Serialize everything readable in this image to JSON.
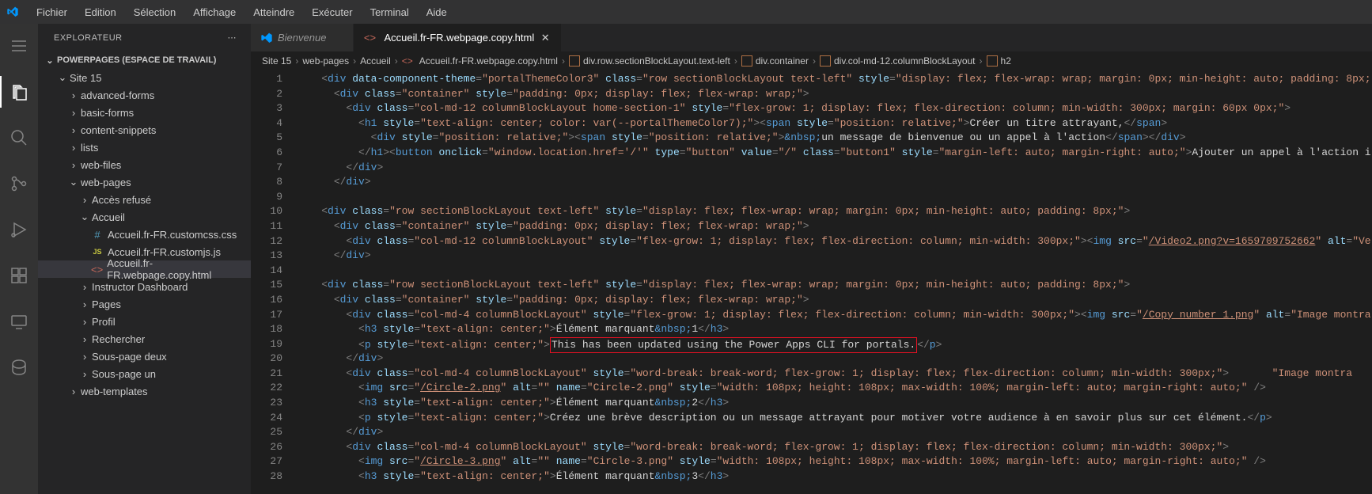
{
  "menubar": [
    "Fichier",
    "Edition",
    "Sélection",
    "Affichage",
    "Atteindre",
    "Exécuter",
    "Terminal",
    "Aide"
  ],
  "sidebar": {
    "title": "EXPLORATEUR",
    "workspace": "POWERPAGES (ESPACE DE TRAVAIL)",
    "root": "Site 15",
    "folders": [
      "advanced-forms",
      "basic-forms",
      "content-snippets",
      "lists",
      "web-files"
    ],
    "webpages": "web-pages",
    "webpages_children": [
      "Accès refusé"
    ],
    "accueil": "Accueil",
    "accueil_files": [
      {
        "name": "Accueil.fr-FR.customcss.css",
        "type": "css",
        "sym": "#"
      },
      {
        "name": "Accueil.fr-FR.customjs.js",
        "type": "js",
        "sym": "JS"
      },
      {
        "name": "Accueil.fr-FR.webpage.copy.html",
        "type": "html",
        "sym": "<>",
        "active": true
      }
    ],
    "after_accueil": [
      "Instructor Dashboard",
      "Pages",
      "Profil",
      "Rechercher",
      "Sous-page deux",
      "Sous-page un"
    ],
    "after_webpages": [
      "web-templates"
    ]
  },
  "tabs": [
    {
      "label": "Bienvenue",
      "active": false,
      "icon": "vscode"
    },
    {
      "label": "Accueil.fr-FR.webpage.copy.html",
      "active": true,
      "icon": "html"
    }
  ],
  "breadcrumbs": [
    {
      "text": "Site 15",
      "kind": "plain"
    },
    {
      "text": "web-pages",
      "kind": "plain"
    },
    {
      "text": "Accueil",
      "kind": "plain"
    },
    {
      "text": "Accueil.fr-FR.webpage.copy.html",
      "kind": "file"
    },
    {
      "text": "div.row.sectionBlockLayout.text-left",
      "kind": "symbol"
    },
    {
      "text": "div.container",
      "kind": "symbol"
    },
    {
      "text": "div.col-md-12.columnBlockLayout",
      "kind": "symbol"
    },
    {
      "text": "h2",
      "kind": "symbol"
    }
  ],
  "line_start": 1,
  "line_end": 28,
  "code_lines": [
    [
      [
        "    ",
        "t-text"
      ],
      [
        "<",
        "t-br"
      ],
      [
        "div",
        "t-tag"
      ],
      [
        " data-component-theme",
        "t-attr"
      ],
      [
        "=",
        "t-br"
      ],
      [
        "\"portalThemeColor3\"",
        "t-str"
      ],
      [
        " class",
        "t-attr"
      ],
      [
        "=",
        "t-br"
      ],
      [
        "\"row sectionBlockLayout text-left\"",
        "t-str"
      ],
      [
        " style",
        "t-attr"
      ],
      [
        "=",
        "t-br"
      ],
      [
        "\"display: flex; flex-wrap: wrap; margin: 0px; min-height: auto; padding: 8px;",
        "t-str"
      ]
    ],
    [
      [
        "      ",
        "t-text"
      ],
      [
        "<",
        "t-br"
      ],
      [
        "div",
        "t-tag"
      ],
      [
        " class",
        "t-attr"
      ],
      [
        "=",
        "t-br"
      ],
      [
        "\"container\"",
        "t-str"
      ],
      [
        " style",
        "t-attr"
      ],
      [
        "=",
        "t-br"
      ],
      [
        "\"padding: 0px; display: flex; flex-wrap: wrap;\"",
        "t-str"
      ],
      [
        ">",
        "t-br"
      ]
    ],
    [
      [
        "        ",
        "t-text"
      ],
      [
        "<",
        "t-br"
      ],
      [
        "div",
        "t-tag"
      ],
      [
        " class",
        "t-attr"
      ],
      [
        "=",
        "t-br"
      ],
      [
        "\"col-md-12 columnBlockLayout home-section-1\"",
        "t-str"
      ],
      [
        " style",
        "t-attr"
      ],
      [
        "=",
        "t-br"
      ],
      [
        "\"flex-grow: 1; display: flex; flex-direction: column; min-width: 300px; margin: 60px 0px;\"",
        "t-str"
      ],
      [
        ">",
        "t-br"
      ]
    ],
    [
      [
        "          ",
        "t-text"
      ],
      [
        "<",
        "t-br"
      ],
      [
        "h1",
        "t-tag"
      ],
      [
        " style",
        "t-attr"
      ],
      [
        "=",
        "t-br"
      ],
      [
        "\"text-align: center; color: var(--portalThemeColor7);\"",
        "t-str"
      ],
      [
        ">",
        "t-br"
      ],
      [
        "<",
        "t-br"
      ],
      [
        "span",
        "t-tag"
      ],
      [
        " style",
        "t-attr"
      ],
      [
        "=",
        "t-br"
      ],
      [
        "\"position: relative;\"",
        "t-str"
      ],
      [
        ">",
        "t-br"
      ],
      [
        "Créer un titre attrayant,",
        "t-text"
      ],
      [
        "</",
        "t-br"
      ],
      [
        "span",
        "t-tag"
      ],
      [
        ">",
        "t-br"
      ]
    ],
    [
      [
        "            ",
        "t-text"
      ],
      [
        "<",
        "t-br"
      ],
      [
        "div",
        "t-tag"
      ],
      [
        " style",
        "t-attr"
      ],
      [
        "=",
        "t-br"
      ],
      [
        "\"position: relative;\"",
        "t-str"
      ],
      [
        ">",
        "t-br"
      ],
      [
        "<",
        "t-br"
      ],
      [
        "span",
        "t-tag"
      ],
      [
        " style",
        "t-attr"
      ],
      [
        "=",
        "t-br"
      ],
      [
        "\"position: relative;\"",
        "t-str"
      ],
      [
        ">",
        "t-br"
      ],
      [
        "&nbsp;",
        "t-ent"
      ],
      [
        "un message de bienvenue ou un appel à l'action",
        "t-text"
      ],
      [
        "</",
        "t-br"
      ],
      [
        "span",
        "t-tag"
      ],
      [
        ">",
        "t-br"
      ],
      [
        "</",
        "t-br"
      ],
      [
        "div",
        "t-tag"
      ],
      [
        ">",
        "t-br"
      ]
    ],
    [
      [
        "          ",
        "t-text"
      ],
      [
        "</",
        "t-br"
      ],
      [
        "h1",
        "t-tag"
      ],
      [
        ">",
        "t-br"
      ],
      [
        "<",
        "t-br"
      ],
      [
        "button",
        "t-tag"
      ],
      [
        " onclick",
        "t-attr"
      ],
      [
        "=",
        "t-br"
      ],
      [
        "\"window.location.href='/'\"",
        "t-str"
      ],
      [
        " type",
        "t-attr"
      ],
      [
        "=",
        "t-br"
      ],
      [
        "\"button\"",
        "t-str"
      ],
      [
        " value",
        "t-attr"
      ],
      [
        "=",
        "t-br"
      ],
      [
        "\"/\"",
        "t-str"
      ],
      [
        " class",
        "t-attr"
      ],
      [
        "=",
        "t-br"
      ],
      [
        "\"button1\"",
        "t-str"
      ],
      [
        " style",
        "t-attr"
      ],
      [
        "=",
        "t-br"
      ],
      [
        "\"margin-left: auto; margin-right: auto;\"",
        "t-str"
      ],
      [
        ">",
        "t-br"
      ],
      [
        "Ajouter un appel à l'action i",
        "t-text"
      ]
    ],
    [
      [
        "        ",
        "t-text"
      ],
      [
        "</",
        "t-br"
      ],
      [
        "div",
        "t-tag"
      ],
      [
        ">",
        "t-br"
      ]
    ],
    [
      [
        "      ",
        "t-text"
      ],
      [
        "</",
        "t-br"
      ],
      [
        "div",
        "t-tag"
      ],
      [
        ">",
        "t-br"
      ]
    ],
    [
      [
        "",
        "t-text"
      ]
    ],
    [
      [
        "    ",
        "t-text"
      ],
      [
        "<",
        "t-br"
      ],
      [
        "div",
        "t-tag"
      ],
      [
        " class",
        "t-attr"
      ],
      [
        "=",
        "t-br"
      ],
      [
        "\"row sectionBlockLayout text-left\"",
        "t-str"
      ],
      [
        " style",
        "t-attr"
      ],
      [
        "=",
        "t-br"
      ],
      [
        "\"display: flex; flex-wrap: wrap; margin: 0px; min-height: auto; padding: 8px;\"",
        "t-str"
      ],
      [
        ">",
        "t-br"
      ]
    ],
    [
      [
        "      ",
        "t-text"
      ],
      [
        "<",
        "t-br"
      ],
      [
        "div",
        "t-tag"
      ],
      [
        " class",
        "t-attr"
      ],
      [
        "=",
        "t-br"
      ],
      [
        "\"container\"",
        "t-str"
      ],
      [
        " style",
        "t-attr"
      ],
      [
        "=",
        "t-br"
      ],
      [
        "\"padding: 0px; display: flex; flex-wrap: wrap;\"",
        "t-str"
      ],
      [
        ">",
        "t-br"
      ]
    ],
    [
      [
        "        ",
        "t-text"
      ],
      [
        "<",
        "t-br"
      ],
      [
        "div",
        "t-tag"
      ],
      [
        " class",
        "t-attr"
      ],
      [
        "=",
        "t-br"
      ],
      [
        "\"col-md-12 columnBlockLayout\"",
        "t-str"
      ],
      [
        " style",
        "t-attr"
      ],
      [
        "=",
        "t-br"
      ],
      [
        "\"flex-grow: 1; display: flex; flex-direction: column; min-width: 300px;\"",
        "t-str"
      ],
      [
        ">",
        "t-br"
      ],
      [
        "<",
        "t-br"
      ],
      [
        "img",
        "t-tag"
      ],
      [
        " src",
        "t-attr"
      ],
      [
        "=",
        "t-br"
      ],
      [
        "\"",
        "t-str"
      ],
      [
        "/Video2.png?v=1659709752662",
        "t-link"
      ],
      [
        "\"",
        "t-str"
      ],
      [
        " alt",
        "t-attr"
      ],
      [
        "=",
        "t-br"
      ],
      [
        "\"Ve",
        "t-str"
      ]
    ],
    [
      [
        "      ",
        "t-text"
      ],
      [
        "</",
        "t-br"
      ],
      [
        "div",
        "t-tag"
      ],
      [
        ">",
        "t-br"
      ]
    ],
    [
      [
        "",
        "t-text"
      ]
    ],
    [
      [
        "    ",
        "t-text"
      ],
      [
        "<",
        "t-br"
      ],
      [
        "div",
        "t-tag"
      ],
      [
        " class",
        "t-attr"
      ],
      [
        "=",
        "t-br"
      ],
      [
        "\"row sectionBlockLayout text-left\"",
        "t-str"
      ],
      [
        " style",
        "t-attr"
      ],
      [
        "=",
        "t-br"
      ],
      [
        "\"display: flex; flex-wrap: wrap; margin: 0px; min-height: auto; padding: 8px;\"",
        "t-str"
      ],
      [
        ">",
        "t-br"
      ]
    ],
    [
      [
        "      ",
        "t-text"
      ],
      [
        "<",
        "t-br"
      ],
      [
        "div",
        "t-tag"
      ],
      [
        " class",
        "t-attr"
      ],
      [
        "=",
        "t-br"
      ],
      [
        "\"container\"",
        "t-str"
      ],
      [
        " style",
        "t-attr"
      ],
      [
        "=",
        "t-br"
      ],
      [
        "\"padding: 0px; display: flex; flex-wrap: wrap;\"",
        "t-str"
      ],
      [
        ">",
        "t-br"
      ]
    ],
    [
      [
        "        ",
        "t-text"
      ],
      [
        "<",
        "t-br"
      ],
      [
        "div",
        "t-tag"
      ],
      [
        " class",
        "t-attr"
      ],
      [
        "=",
        "t-br"
      ],
      [
        "\"col-md-4 columnBlockLayout\"",
        "t-str"
      ],
      [
        " style",
        "t-attr"
      ],
      [
        "=",
        "t-br"
      ],
      [
        "\"flex-grow: 1; display: flex; flex-direction: column; min-width: 300px;\"",
        "t-str"
      ],
      [
        ">",
        "t-br"
      ],
      [
        "<",
        "t-br"
      ],
      [
        "img",
        "t-tag"
      ],
      [
        " src",
        "t-attr"
      ],
      [
        "=",
        "t-br"
      ],
      [
        "\"",
        "t-str"
      ],
      [
        "/Copy number 1.png",
        "t-link"
      ],
      [
        "\"",
        "t-str"
      ],
      [
        " alt",
        "t-attr"
      ],
      [
        "=",
        "t-br"
      ],
      [
        "\"Image montra",
        "t-str"
      ]
    ],
    [
      [
        "          ",
        "t-text"
      ],
      [
        "<",
        "t-br"
      ],
      [
        "h3",
        "t-tag"
      ],
      [
        " style",
        "t-attr"
      ],
      [
        "=",
        "t-br"
      ],
      [
        "\"text-align: center;\"",
        "t-str"
      ],
      [
        ">",
        "t-br"
      ],
      [
        "Élément marquant",
        "t-text"
      ],
      [
        "&nbsp;",
        "t-ent"
      ],
      [
        "1",
        "t-text"
      ],
      [
        "</",
        "t-br"
      ],
      [
        "h3",
        "t-tag"
      ],
      [
        ">",
        "t-br"
      ]
    ],
    [
      [
        "          ",
        "t-text"
      ],
      [
        "<",
        "t-br"
      ],
      [
        "p",
        "t-tag"
      ],
      [
        " style",
        "t-attr"
      ],
      [
        "=",
        "t-br"
      ],
      [
        "\"text-align: center;\"",
        "t-str"
      ],
      [
        ">",
        "t-br"
      ],
      [
        "REDBOX_START",
        "t-text"
      ],
      [
        "This has been updated using the Power Apps CLI for portals.",
        "t-text"
      ],
      [
        "REDBOX_END",
        "t-text"
      ],
      [
        "</",
        "t-br"
      ],
      [
        "p",
        "t-tag"
      ],
      [
        ">",
        "t-br"
      ]
    ],
    [
      [
        "        ",
        "t-text"
      ],
      [
        "</",
        "t-br"
      ],
      [
        "div",
        "t-tag"
      ],
      [
        ">",
        "t-br"
      ]
    ],
    [
      [
        "        ",
        "t-text"
      ],
      [
        "<",
        "t-br"
      ],
      [
        "div",
        "t-tag"
      ],
      [
        " class",
        "t-attr"
      ],
      [
        "=",
        "t-br"
      ],
      [
        "\"col-md-4 columnBlockLayout\"",
        "t-str"
      ],
      [
        " style",
        "t-attr"
      ],
      [
        "=",
        "t-br"
      ],
      [
        "\"word-break: break-word; flex-grow: 1; display: flex; flex-direction: column; min-width: 300px;\"",
        "t-str"
      ],
      [
        ">       ",
        "t-br"
      ],
      [
        "\"Image montra",
        "t-str"
      ]
    ],
    [
      [
        "          ",
        "t-text"
      ],
      [
        "<",
        "t-br"
      ],
      [
        "img",
        "t-tag"
      ],
      [
        " src",
        "t-attr"
      ],
      [
        "=",
        "t-br"
      ],
      [
        "\"",
        "t-str"
      ],
      [
        "/Circle-2.png",
        "t-link"
      ],
      [
        "\"",
        "t-str"
      ],
      [
        " alt",
        "t-attr"
      ],
      [
        "=",
        "t-br"
      ],
      [
        "\"\"",
        "t-str"
      ],
      [
        " name",
        "t-attr"
      ],
      [
        "=",
        "t-br"
      ],
      [
        "\"Circle-2.png\"",
        "t-str"
      ],
      [
        " style",
        "t-attr"
      ],
      [
        "=",
        "t-br"
      ],
      [
        "\"width: 108px; height: 108px; max-width: 100%; margin-left: auto; margin-right: auto;\"",
        "t-str"
      ],
      [
        " />",
        "t-br"
      ]
    ],
    [
      [
        "          ",
        "t-text"
      ],
      [
        "<",
        "t-br"
      ],
      [
        "h3",
        "t-tag"
      ],
      [
        " style",
        "t-attr"
      ],
      [
        "=",
        "t-br"
      ],
      [
        "\"text-align: center;\"",
        "t-str"
      ],
      [
        ">",
        "t-br"
      ],
      [
        "Élément marquant",
        "t-text"
      ],
      [
        "&nbsp;",
        "t-ent"
      ],
      [
        "2",
        "t-text"
      ],
      [
        "</",
        "t-br"
      ],
      [
        "h3",
        "t-tag"
      ],
      [
        ">",
        "t-br"
      ]
    ],
    [
      [
        "          ",
        "t-text"
      ],
      [
        "<",
        "t-br"
      ],
      [
        "p",
        "t-tag"
      ],
      [
        " style",
        "t-attr"
      ],
      [
        "=",
        "t-br"
      ],
      [
        "\"text-align: center;\"",
        "t-str"
      ],
      [
        ">",
        "t-br"
      ],
      [
        "Créez une brève description ou un message attrayant pour motiver votre audience à en savoir plus sur cet élément.",
        "t-text"
      ],
      [
        "</",
        "t-br"
      ],
      [
        "p",
        "t-tag"
      ],
      [
        ">",
        "t-br"
      ]
    ],
    [
      [
        "        ",
        "t-text"
      ],
      [
        "</",
        "t-br"
      ],
      [
        "div",
        "t-tag"
      ],
      [
        ">                                                                                                                                                                                   ",
        "t-br"
      ],
      [
        "\"Image montra",
        "t-str"
      ]
    ],
    [
      [
        "        ",
        "t-text"
      ],
      [
        "<",
        "t-br"
      ],
      [
        "div",
        "t-tag"
      ],
      [
        " class",
        "t-attr"
      ],
      [
        "=",
        "t-br"
      ],
      [
        "\"col-md-4 columnBlockLayout\"",
        "t-str"
      ],
      [
        " style",
        "t-attr"
      ],
      [
        "=",
        "t-br"
      ],
      [
        "\"word-break: break-word; flex-grow: 1; display: flex; flex-direction: column; min-width: 300px;\"",
        "t-str"
      ],
      [
        ">",
        "t-br"
      ]
    ],
    [
      [
        "          ",
        "t-text"
      ],
      [
        "<",
        "t-br"
      ],
      [
        "img",
        "t-tag"
      ],
      [
        " src",
        "t-attr"
      ],
      [
        "=",
        "t-br"
      ],
      [
        "\"",
        "t-str"
      ],
      [
        "/Circle-3.png",
        "t-link"
      ],
      [
        "\"",
        "t-str"
      ],
      [
        " alt",
        "t-attr"
      ],
      [
        "=",
        "t-br"
      ],
      [
        "\"\"",
        "t-str"
      ],
      [
        " name",
        "t-attr"
      ],
      [
        "=",
        "t-br"
      ],
      [
        "\"Circle-3.png\"",
        "t-str"
      ],
      [
        " style",
        "t-attr"
      ],
      [
        "=",
        "t-br"
      ],
      [
        "\"width: 108px; height: 108px; max-width: 100%; margin-left: auto; margin-right: auto;\"",
        "t-str"
      ],
      [
        " />",
        "t-br"
      ]
    ],
    [
      [
        "          ",
        "t-text"
      ],
      [
        "<",
        "t-br"
      ],
      [
        "h3",
        "t-tag"
      ],
      [
        " style",
        "t-attr"
      ],
      [
        "=",
        "t-br"
      ],
      [
        "\"text-align: center;\"",
        "t-str"
      ],
      [
        ">",
        "t-br"
      ],
      [
        "Élément marquant",
        "t-text"
      ],
      [
        "&nbsp;",
        "t-ent"
      ],
      [
        "3",
        "t-text"
      ],
      [
        "</",
        "t-br"
      ],
      [
        "h3",
        "t-tag"
      ],
      [
        ">",
        "t-br"
      ]
    ]
  ]
}
